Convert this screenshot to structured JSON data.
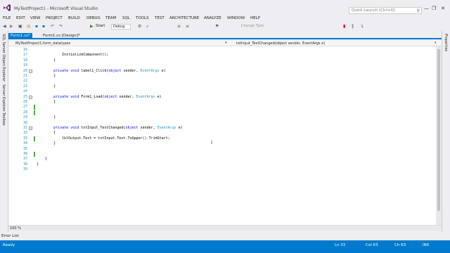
{
  "window": {
    "title": "MyTestProject1 - Microsoft Visual Studio",
    "quick_launch_placeholder": "Quick Launch (Ctrl+Q)",
    "controls": [
      "—",
      "❐",
      "✕"
    ]
  },
  "menu": [
    "FILE",
    "EDIT",
    "VIEW",
    "PROJECT",
    "BUILD",
    "DEBUG",
    "TEAM",
    "SQL",
    "TOOLS",
    "TEST",
    "ARCHITECTURE",
    "ANALYZE",
    "WINDOW",
    "HELP"
  ],
  "toolbar": {
    "start_label": "Start",
    "config_label": "Debug",
    "change_type_label": "Change Type"
  },
  "tabs": [
    {
      "label": "Form1.cs*",
      "active": true
    },
    {
      "label": "Form1.cs [Design]*",
      "active": false
    }
  ],
  "left_strip": [
    "SQL Server Object Explorer",
    "Server Explorer",
    "Toolbox"
  ],
  "right_strip": [
    "Properties"
  ],
  "nav": {
    "class_combo": "MyTestProject1.form_datatypes",
    "member_combo": "txtInput_TextChanged(object sender, EventArgs e)"
  },
  "code": {
    "lines": [
      {
        "no": "16",
        "text": ""
      },
      {
        "no": "17",
        "text": "            InitializeComponent();"
      },
      {
        "no": "18",
        "text": "        }"
      },
      {
        "no": "19",
        "text": ""
      },
      {
        "no": "20",
        "text": "        private void label1_Click(object sender, EventArgs e)"
      },
      {
        "no": "21",
        "text": "        {"
      },
      {
        "no": "22",
        "text": ""
      },
      {
        "no": "23",
        "text": "        }"
      },
      {
        "no": "24",
        "text": ""
      },
      {
        "no": "25",
        "text": "        private void Form1_Load(object sender, EventArgs e)"
      },
      {
        "no": "26",
        "text": "        {"
      },
      {
        "no": "27",
        "text": ""
      },
      {
        "no": "28",
        "text": ""
      },
      {
        "no": "29",
        "text": "        }"
      },
      {
        "no": "30",
        "text": ""
      },
      {
        "no": "31",
        "text": "        private void txtInput_TextChanged(object sender, EventArgs e)"
      },
      {
        "no": "32",
        "text": "        {"
      },
      {
        "no": "33",
        "text": "            lblOutput.Text = txtInput.Text.ToUpper().TrimStart;"
      },
      {
        "no": "34",
        "text": "        }"
      },
      {
        "no": "35",
        "text": ""
      },
      {
        "no": "36",
        "text": ""
      },
      {
        "no": "37",
        "text": "    }"
      },
      {
        "no": "38",
        "text": "}"
      },
      {
        "no": "39",
        "text": ""
      }
    ]
  },
  "zoom": "100 %",
  "error_list_label": "Error List",
  "status": {
    "state": "Ready",
    "line": "Ln 33",
    "col": "Col 63",
    "ch": "Ch 63",
    "mode": "INS"
  },
  "colors": {
    "accent": "#007acc",
    "keyword": "#0000ff",
    "type": "#2b91af",
    "line_number": "#2b91af",
    "changed_marker": "#57a64a"
  }
}
